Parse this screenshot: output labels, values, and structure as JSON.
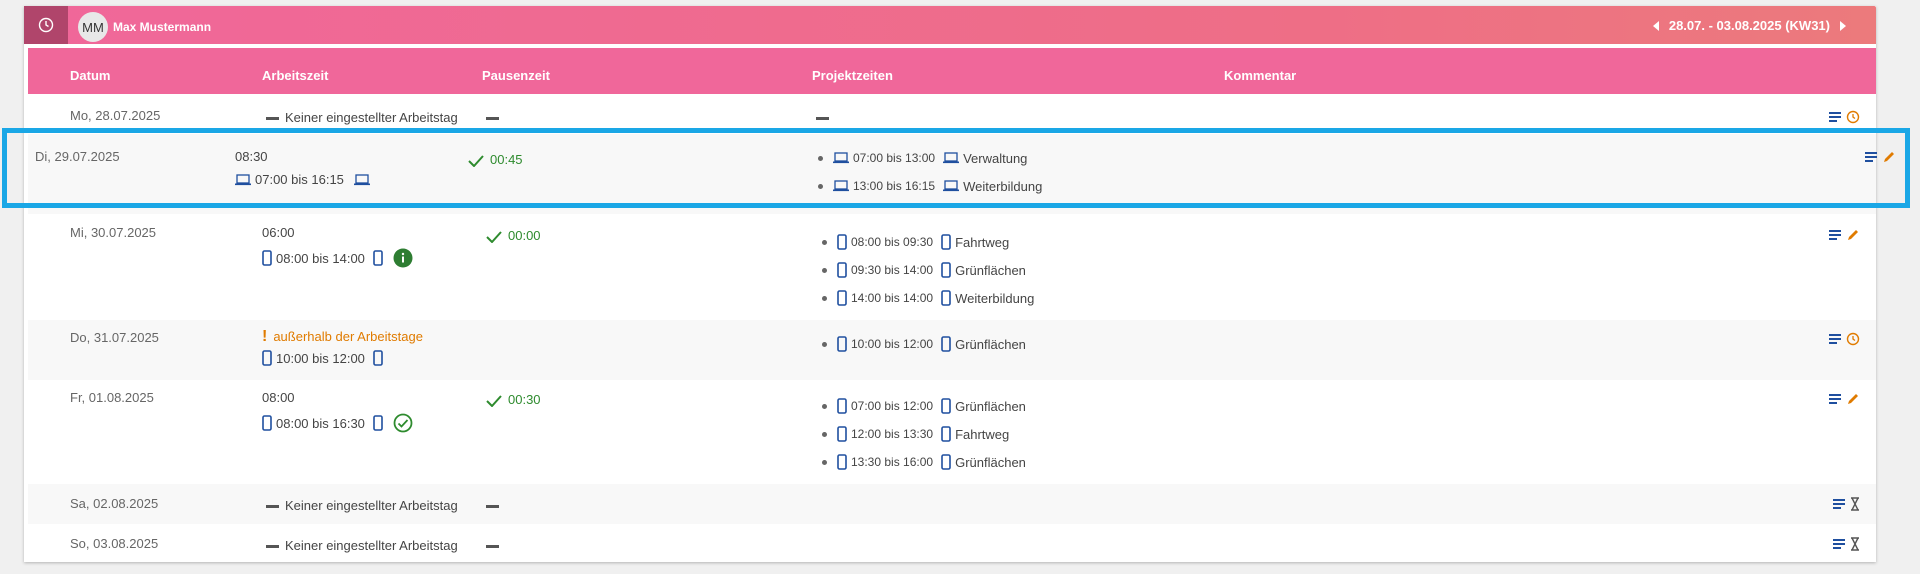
{
  "topbar": {
    "avatar_initials": "MM",
    "user_name": "Max Mustermann",
    "week_range": "28.07. - 03.08.2025 (KW31)"
  },
  "columns": {
    "datum": "Datum",
    "arbeitszeit": "Arbeitszeit",
    "pausenzeit": "Pausenzeit",
    "projektzeiten": "Projektzeiten",
    "kommentar": "Kommentar"
  },
  "rows": [
    {
      "date": "Mo, 28.07.2025",
      "note": "Keiner eingestellter Arbeitstag"
    },
    {
      "date": "Di, 29.07.2025",
      "hours": "08:30",
      "span": "07:00 bis 16:15",
      "pause": "00:45",
      "projects": [
        {
          "time": "07:00 bis 13:00",
          "activity": "Verwaltung"
        },
        {
          "time": "13:00 bis 16:15",
          "activity": "Weiterbildung"
        }
      ]
    },
    {
      "date": "Mi, 30.07.2025",
      "hours": "06:00",
      "span": "08:00 bis 14:00",
      "pause": "00:00",
      "projects": [
        {
          "time": "08:00 bis 09:30",
          "activity": "Fahrtweg"
        },
        {
          "time": "09:30 bis 14:00",
          "activity": "Grünflächen"
        },
        {
          "time": "14:00 bis 14:00",
          "activity": "Weiterbildung"
        }
      ]
    },
    {
      "date": "Do, 31.07.2025",
      "warning": "außerhalb der Arbeitstage",
      "span": "10:00 bis 12:00",
      "projects": [
        {
          "time": "10:00 bis 12:00",
          "activity": "Grünflächen"
        }
      ]
    },
    {
      "date": "Fr, 01.08.2025",
      "hours": "08:00",
      "span": "08:00 bis 16:30",
      "pause": "00:30",
      "projects": [
        {
          "time": "07:00 bis 12:00",
          "activity": "Grünflächen"
        },
        {
          "time": "12:00 bis 13:30",
          "activity": "Fahrtweg"
        },
        {
          "time": "13:30 bis 16:00",
          "activity": "Grünflächen"
        }
      ]
    },
    {
      "date": "Sa, 02.08.2025",
      "note": "Keiner eingestellter Arbeitstag"
    },
    {
      "date": "So, 03.08.2025",
      "note": "Keiner eingestellter Arbeitstag"
    }
  ],
  "colors": {
    "brand_pink": "#f0679a",
    "highlight": "#1aa7e6",
    "ok_green": "#2e8b2e",
    "warn_orange": "#e07b00",
    "icon_blue": "#1f4f9f"
  }
}
